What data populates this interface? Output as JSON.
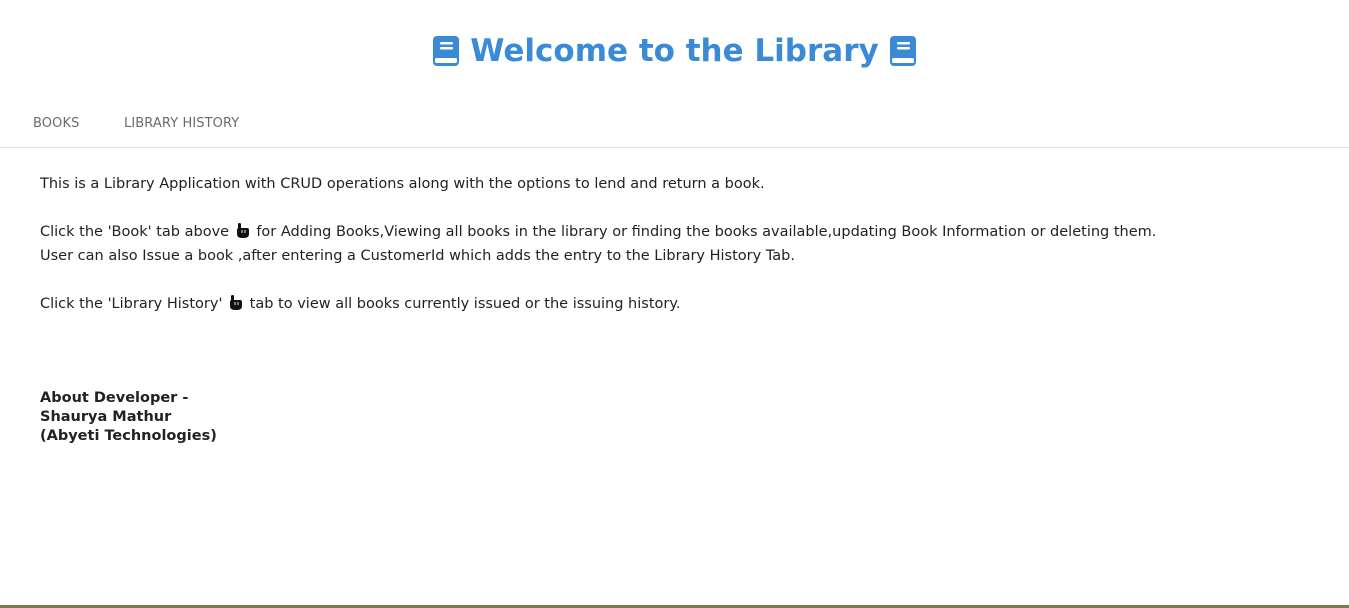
{
  "header": {
    "title": "Welcome to the Library",
    "left_icon": "blue-book-icon",
    "right_icon": "blue-book-icon"
  },
  "tabs": [
    {
      "label": "Books"
    },
    {
      "label": "Library History"
    }
  ],
  "content": {
    "line1": "This is a Library Application with CRUD operations along with the options to lend and return a book.",
    "line2_before": "Click the 'Book' tab above",
    "line2_after": "for Adding Books,Viewing all books in the library or finding the books available,updating Book Information or deleting them.",
    "line3": "User can also Issue a book ,after entering a CustomerId which adds the entry to the Library History Tab.",
    "line4_before": "Click the 'Library History'",
    "line4_after": "tab to view all books currently issued or the issuing history.",
    "pointer_icon": "pointing-down-hand-icon"
  },
  "about": {
    "heading": "About Developer -",
    "name": "Shaurya Mathur",
    "company": "(Abyeti Technologies)"
  },
  "colors": {
    "title": "#3b8ad5",
    "tab_text": "#6b6b6b",
    "body_text": "#222222",
    "divider": "#e3e3e3",
    "bottom_line": "#7c7b4e"
  }
}
